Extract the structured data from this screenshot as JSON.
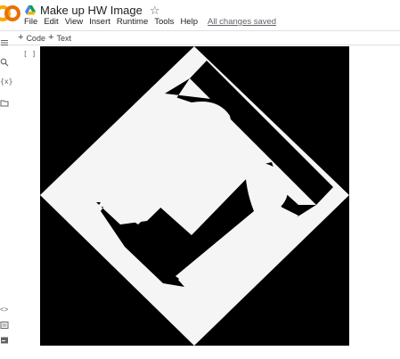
{
  "app": {
    "logo_text": "CO",
    "logo_color": "#f9ab00",
    "doc_title": "Make up HW Image",
    "menu": [
      "File",
      "Edit",
      "View",
      "Insert",
      "Runtime",
      "Tools",
      "Help"
    ],
    "save_status": "All changes saved"
  },
  "toolbar": {
    "add_code": "Code",
    "add_text": "Text"
  },
  "sidebar": {
    "icons": [
      "menu-icon",
      "search-icon",
      "variables-icon",
      "folder-icon",
      "code-snippets-icon",
      "command-palette-icon",
      "terminal-icon"
    ]
  },
  "cell": {
    "run_indicator": "[ ]",
    "output": {
      "description_icon": "rotated-letter-i-image",
      "background": "#000000",
      "shape_color": "#f5f5f5"
    }
  }
}
